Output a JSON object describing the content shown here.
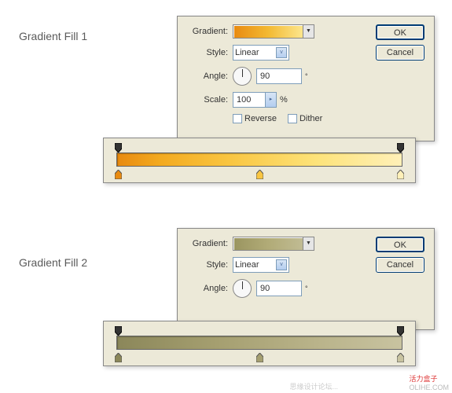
{
  "labels": {
    "fill1": "Gradient Fill 1",
    "fill2": "Gradient Fill 2"
  },
  "dialog": {
    "gradient_label": "Gradient:",
    "style_label": "Style:",
    "style_value": "Linear",
    "angle_label": "Angle:",
    "angle_value": "90",
    "scale_label": "Scale:",
    "scale_value": "100",
    "percent": "%",
    "degree": "°",
    "reverse": "Reverse",
    "dither": "Dither",
    "ok": "OK",
    "cancel": "Cancel"
  },
  "editor1": {
    "stops": [
      "#e88a10",
      "#f9c642",
      "#fff0b8"
    ]
  },
  "editor2": {
    "stops": [
      "#8b875a",
      "#a59f70",
      "#c8c3a0"
    ]
  },
  "watermark": {
    "red": "活力盒子",
    "olihe": "OLIHE.COM",
    "cn": "思缘设计论坛..."
  }
}
